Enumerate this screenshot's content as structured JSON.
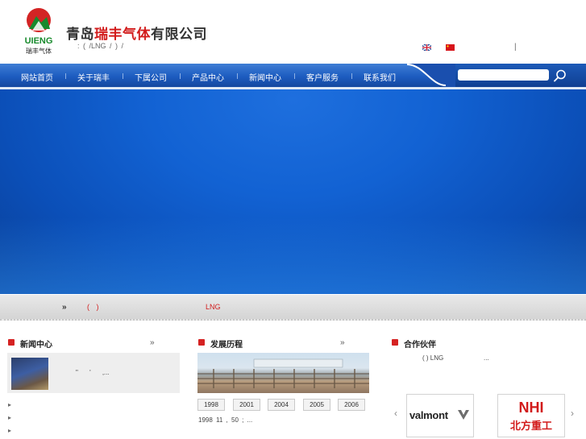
{
  "header": {
    "logo_text": "UIENG",
    "logo_subtext": "瑞丰气体",
    "company_prefix": "青岛",
    "company_accent": "瑞丰气体",
    "company_suffix": "有限公司",
    "slogan": ": ( /LNG / ) /",
    "lang_separator": "|"
  },
  "nav": {
    "items": [
      "网站首页",
      "关于瑞丰",
      "下属公司",
      "产品中心",
      "新闻中心",
      "客户服务",
      "联系我们"
    ],
    "search_placeholder": ""
  },
  "notice": {
    "raquo": "»",
    "paren": "( )",
    "lng": "LNG"
  },
  "sections": {
    "news": {
      "title": "新闻中心",
      "more": "»",
      "snippet": "\" ' ,..."
    },
    "history": {
      "title": "发展历程",
      "more": "»",
      "years": [
        "1998",
        "2001",
        "2004",
        "2005",
        "2006"
      ],
      "text": "1998 11 , 50 ; ..."
    },
    "partners": {
      "title": "合作伙伴",
      "text": "( ) LNG",
      "ellipsis": "...",
      "left_arrow": "‹",
      "right_arrow": "›",
      "logos": [
        "valmont",
        "NHI",
        "北方重工"
      ]
    }
  },
  "colors": {
    "nav_blue": "#1d5cc0",
    "accent_red": "#d21b1b",
    "banner_blue": "#1262d3"
  }
}
